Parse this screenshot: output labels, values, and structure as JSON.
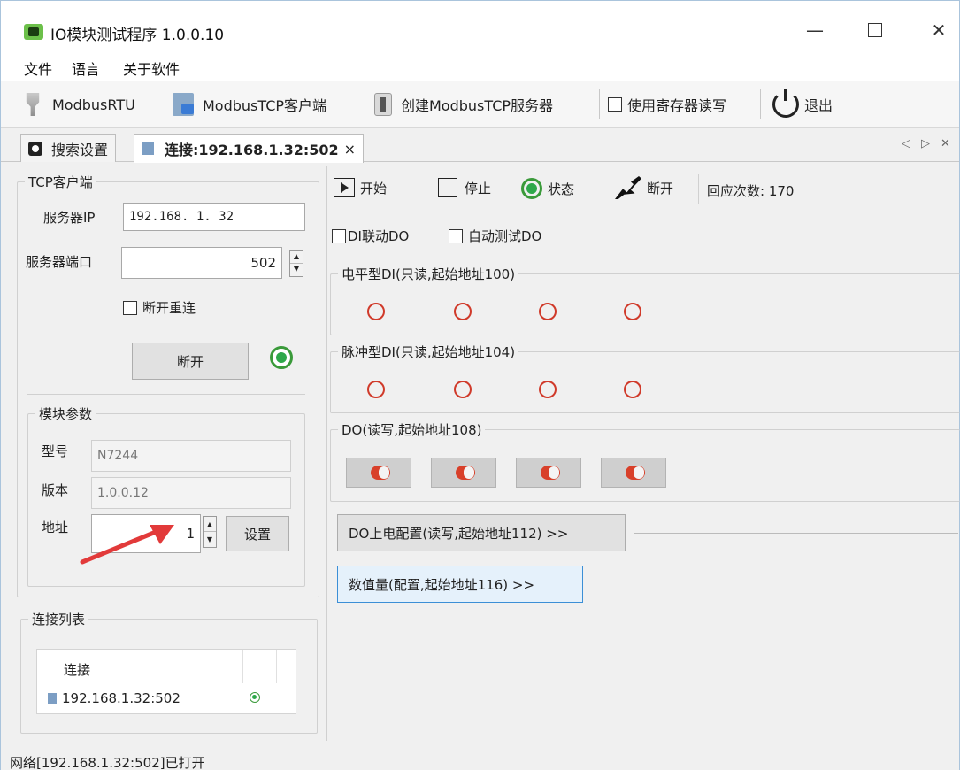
{
  "window": {
    "title": "IO模块测试程序 1.0.0.10",
    "minimize": "—",
    "close": "✕"
  },
  "menu": [
    "文件",
    "语言",
    "关于软件"
  ],
  "toolbar": {
    "modbus_rtu": "ModbusRTU",
    "modbus_tcp_client": "ModbusTCP客户端",
    "create_tcp_server": "创建ModbusTCP服务器",
    "use_register_rw": "使用寄存器读写",
    "exit": "退出"
  },
  "tabs": {
    "search": "搜索设置",
    "connection": "连接:192.168.1.32:502",
    "close": "×",
    "scroll_left": "◁",
    "scroll_right": "▷",
    "scroll_close": "✕"
  },
  "tcp_client": {
    "group_title": "TCP客户端",
    "server_ip_label": "服务器IP",
    "server_ip_value": "192.168.  1. 32",
    "server_port_label": "服务器端口",
    "server_port_value": "502",
    "reconnect_label": "断开重连",
    "disconnect_button": "断开"
  },
  "module_params": {
    "group_title": "模块参数",
    "model_label": "型号",
    "model_value": "N7244",
    "version_label": "版本",
    "version_value": "1.0.0.12",
    "address_label": "地址",
    "address_value": "1",
    "set_button": "设置"
  },
  "connection_list": {
    "group_title": "连接列表",
    "column_header": "连接",
    "items": [
      {
        "address": "192.168.1.32:502"
      }
    ]
  },
  "control_bar": {
    "start": "开始",
    "stop": "停止",
    "status": "状态",
    "disconnect": "断开",
    "reply_count_label": "回应次数: 170",
    "di_link_do": "DI联动DO",
    "auto_test_do": "自动测试DO"
  },
  "sections": {
    "level_di": "电平型DI(只读,起始地址100)",
    "pulse_di": "脉冲型DI(只读,起始地址104)",
    "do": "DO(读写,起始地址108)",
    "do_power_config": "DO上电配置(读写,起始地址112) >>",
    "numeric_config": "数值量(配置,起始地址116) >>"
  },
  "statusbar": {
    "text": "网络[192.168.1.32:502]已打开"
  },
  "colors": {
    "accent_green": "#2ea84a",
    "indicator_red": "#d03a2a",
    "annotation_arrow": "#e23a3a"
  }
}
